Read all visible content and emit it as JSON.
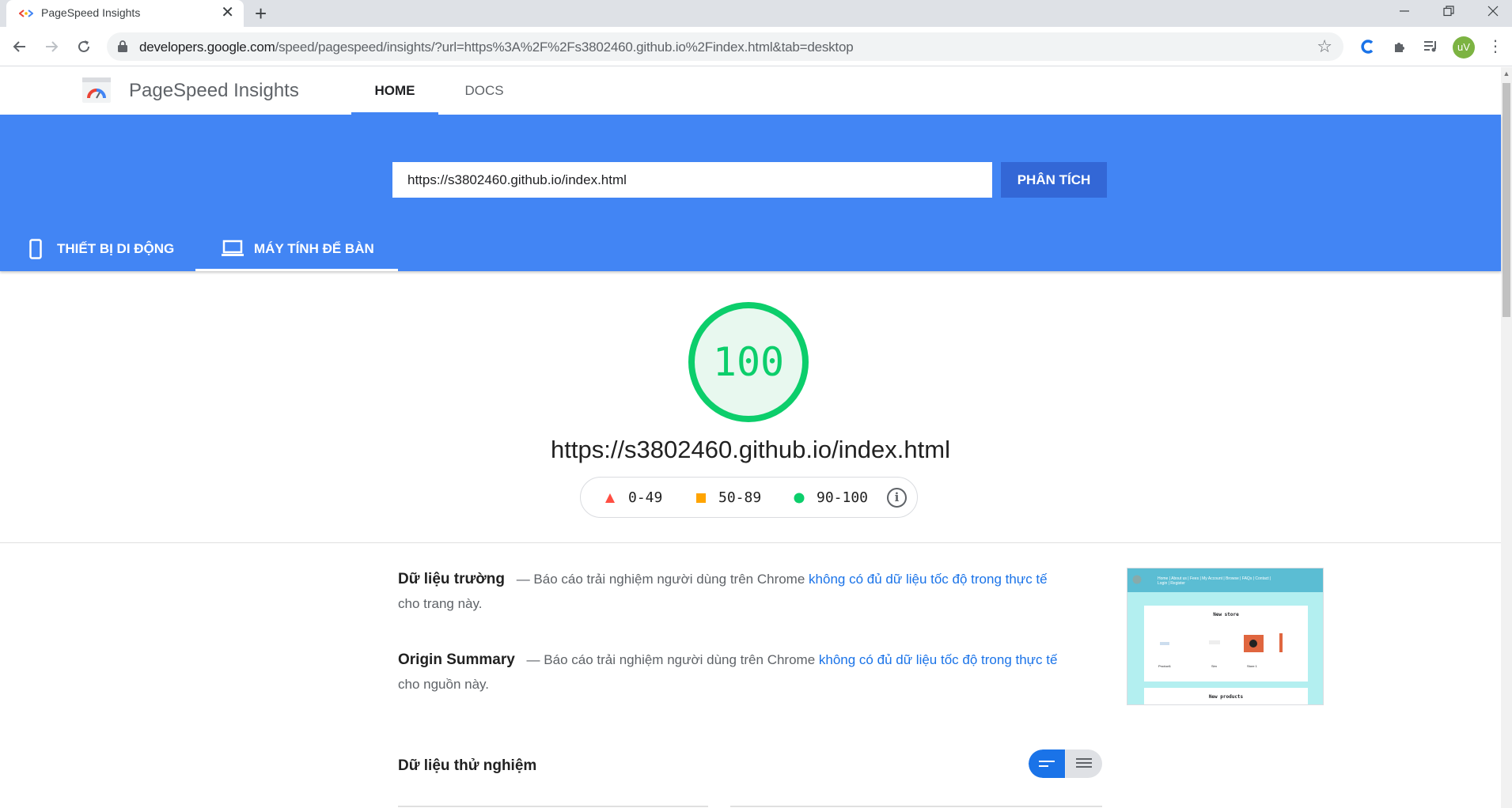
{
  "browser": {
    "tab_title": "PageSpeed Insights",
    "tab_close": "✕",
    "new_tab": "+",
    "url_host": "developers.google.com",
    "url_path": "/speed/pagespeed/insights/?url=https%3A%2F%2Fs3802460.github.io%2Findex.html&tab=desktop",
    "avatar_initials": "uV"
  },
  "header": {
    "title": "PageSpeed Insights",
    "nav": {
      "home": "HOME",
      "docs": "DOCS"
    }
  },
  "hero": {
    "input_value": "https://s3802460.github.io/index.html",
    "analyze_label": "PHÂN TÍCH",
    "tab_mobile": "THIẾT BỊ DI ĐỘNG",
    "tab_desktop": "MÁY TÍNH ĐỂ BÀN",
    "active_tab": "desktop"
  },
  "score": {
    "value": "100",
    "url": "https://s3802460.github.io/index.html",
    "legend": {
      "poor": "0-49",
      "average": "50-89",
      "good": "90-100",
      "info": "i"
    }
  },
  "field_data": {
    "heading": "Dữ liệu trường",
    "text_before": " — Báo cáo trải nghiệm người dùng trên Chrome ",
    "link": "không có đủ dữ liệu tốc độ trong thực tế",
    "text_after": " cho trang này."
  },
  "origin_summary": {
    "heading": "Origin Summary",
    "text_before": " — Báo cáo trải nghiệm người dùng trên Chrome ",
    "link": "không có đủ dữ liệu tốc độ trong thực tế",
    "text_after": " cho nguồn này."
  },
  "lab_data": {
    "heading": "Dữ liệu thử nghiệm"
  },
  "thumbnail": {
    "nav_links": "Home | About us | Fees | My Account | Browse | FAQs | Contact | Login | Register",
    "section1": "New store",
    "section2": "New products",
    "item1": "Product1",
    "item2": "Sim",
    "item3": "Store 1"
  },
  "colors": {
    "brand_blue": "#4285f4",
    "button_blue": "#3367d6",
    "good": "#0cce6b",
    "average": "#ffa400",
    "poor": "#ff4e42",
    "link": "#1a73e8"
  }
}
